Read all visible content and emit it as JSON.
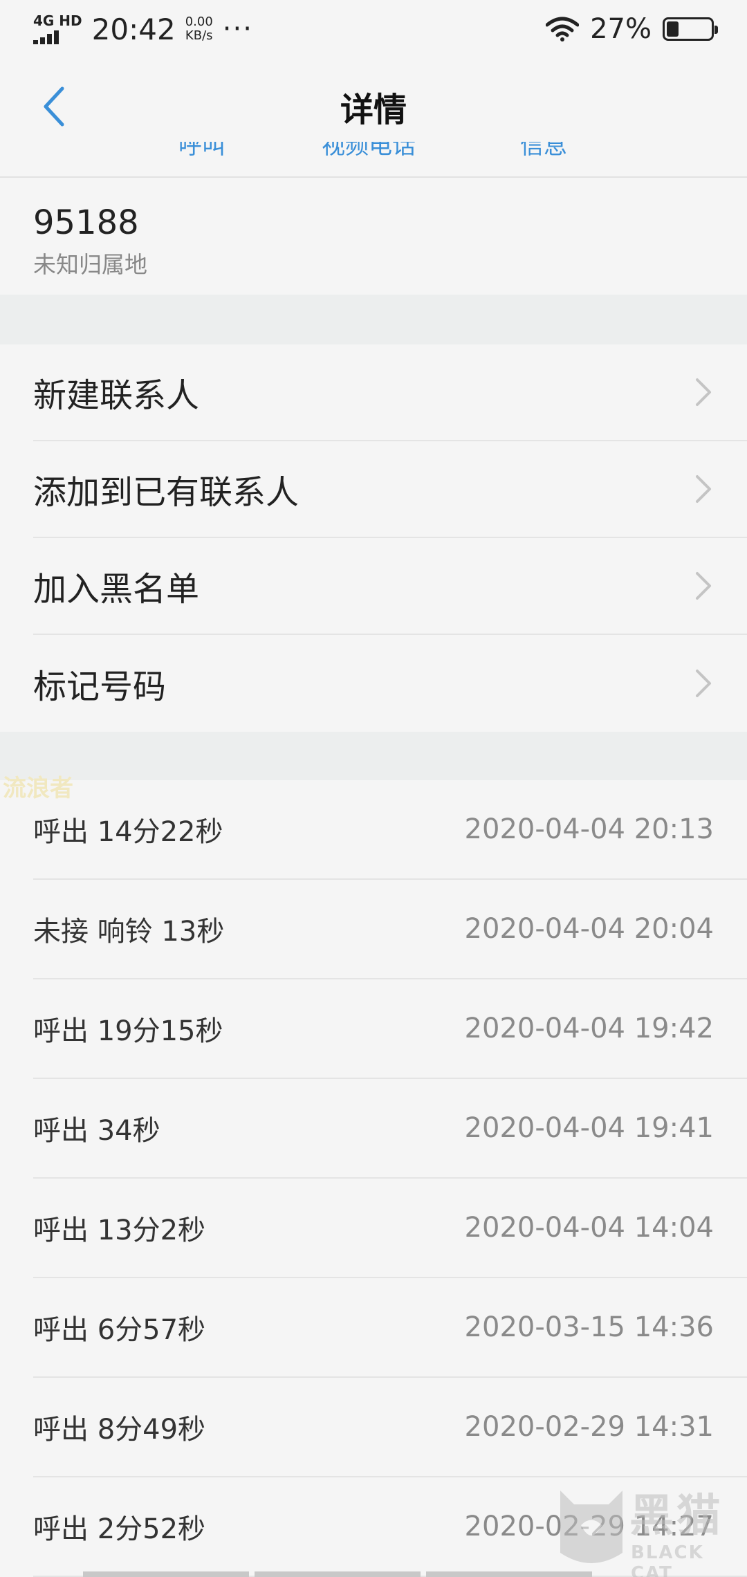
{
  "status_bar": {
    "network": "4G HD",
    "time": "20:42",
    "speed_value": "0.00",
    "speed_unit": "KB/s",
    "more": "···",
    "battery_percent": "27%",
    "battery_level": 0.27
  },
  "nav": {
    "title": "详情",
    "back_icon": "chevron-left-icon"
  },
  "actions": {
    "call": "呼叫",
    "video_call": "视频电话",
    "message": "信息"
  },
  "contact": {
    "number": "95188",
    "location": "未知归属地"
  },
  "menu": {
    "items": [
      {
        "label": "新建联系人"
      },
      {
        "label": "添加到已有联系人"
      },
      {
        "label": "加入黑名单"
      },
      {
        "label": "标记号码"
      }
    ]
  },
  "watermark_text": "流浪者",
  "call_log": [
    {
      "desc": "呼出 14分22秒",
      "time": "2020-04-04 20:13"
    },
    {
      "desc": "未接 响铃 13秒",
      "time": "2020-04-04 20:04"
    },
    {
      "desc": "呼出 19分15秒",
      "time": "2020-04-04 19:42"
    },
    {
      "desc": "呼出 34秒",
      "time": "2020-04-04 19:41"
    },
    {
      "desc": "呼出 13分2秒",
      "time": "2020-04-04 14:04"
    },
    {
      "desc": "呼出 6分57秒",
      "time": "2020-03-15 14:36"
    },
    {
      "desc": "呼出 8分49秒",
      "time": "2020-02-29 14:31"
    },
    {
      "desc": "呼出 2分52秒",
      "time": "2020-02-29 14:27"
    }
  ],
  "logo_watermark": {
    "cn": "黑猫",
    "en": "BLACK CAT"
  },
  "colors": {
    "accent": "#3a8fd8",
    "background": "#f5f5f5",
    "section_gap": "#eceeee"
  }
}
